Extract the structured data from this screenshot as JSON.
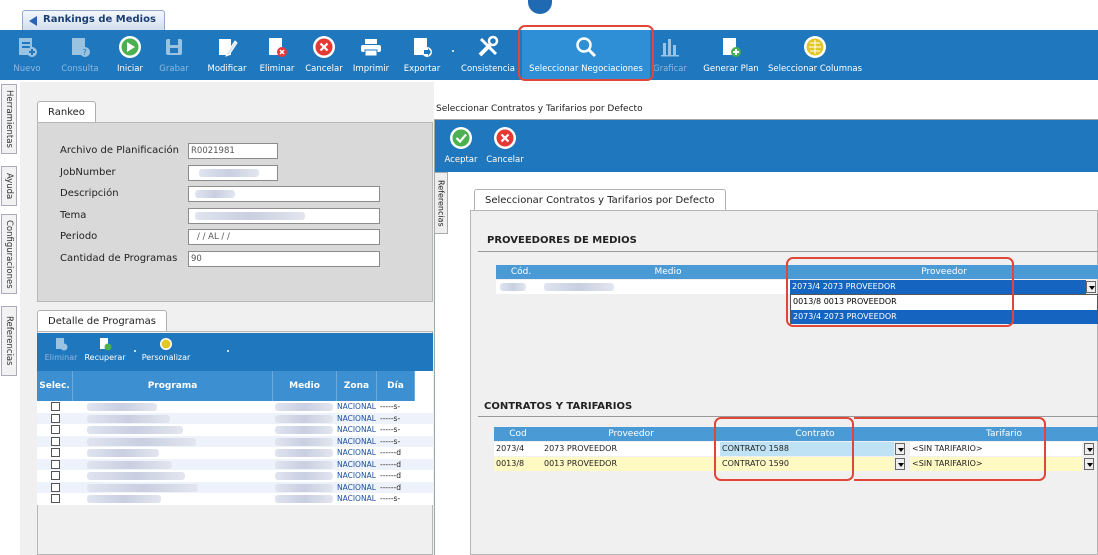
{
  "window": {
    "tab_title": "Rankings de Medios"
  },
  "toolbar": [
    {
      "label": "Nuevo",
      "icon": "new-doc-icon",
      "enabled": false
    },
    {
      "label": "Consulta",
      "icon": "query-doc-icon",
      "enabled": false
    },
    {
      "label": "Iniciar",
      "icon": "play-icon",
      "enabled": true
    },
    {
      "label": "Grabar",
      "icon": "save-icon",
      "enabled": false
    },
    {
      "label": "Modificar",
      "icon": "edit-icon",
      "enabled": true
    },
    {
      "label": "Eliminar",
      "icon": "delete-doc-icon",
      "enabled": true
    },
    {
      "label": "Cancelar",
      "icon": "cancel-icon",
      "enabled": true
    },
    {
      "label": "Imprimir",
      "icon": "print-icon",
      "enabled": true
    },
    {
      "label": "Exportar",
      "icon": "export-icon",
      "enabled": true
    },
    {
      "label": "Consistencia",
      "icon": "tools-icon",
      "enabled": true
    },
    {
      "label": "Seleccionar Negociaciones",
      "icon": "search-icon",
      "enabled": true,
      "selected": true
    },
    {
      "label": "Graficar",
      "icon": "chart-icon",
      "enabled": false
    },
    {
      "label": "Generar Plan",
      "icon": "generate-plan-icon",
      "enabled": true
    },
    {
      "label": "Seleccionar Columnas",
      "icon": "columns-icon",
      "enabled": true
    }
  ],
  "side_tabs": [
    "Herramientas",
    "Ayuda",
    "Configuraciones",
    "Referencias"
  ],
  "rankeo": {
    "tab": "Rankeo",
    "fields": {
      "archivo_label": "Archivo de Planificación",
      "archivo_value": "R0021981",
      "jobnumber_label": "JobNumber",
      "descripcion_label": "Descripción",
      "tema_label": "Tema",
      "periodo_label": "Periodo",
      "periodo_value": "/  /    AL  /  /",
      "cantidad_label": "Cantidad de Programas",
      "cantidad_value": "90"
    }
  },
  "detalle": {
    "tab": "Detalle de Programas",
    "toolbar": [
      "Eliminar",
      "Recuperar",
      "Personalizar"
    ],
    "columns": [
      "Selec.",
      "Programa",
      "Medio",
      "Zona",
      "Día"
    ],
    "rows": [
      {
        "zona": "NACIONAL",
        "dia": "-----s-"
      },
      {
        "zona": "NACIONAL",
        "dia": "-----s-"
      },
      {
        "zona": "NACIONAL",
        "dia": "-----s-"
      },
      {
        "zona": "NACIONAL",
        "dia": "-----s-"
      },
      {
        "zona": "NACIONAL",
        "dia": "------d"
      },
      {
        "zona": "NACIONAL",
        "dia": "------d"
      },
      {
        "zona": "NACIONAL",
        "dia": "------d"
      },
      {
        "zona": "NACIONAL",
        "dia": "------d"
      },
      {
        "zona": "NACIONAL",
        "dia": "-----s-"
      }
    ]
  },
  "dialog": {
    "title": "Seleccionar Contratos y Tarifarios por Defecto",
    "toolbar": {
      "accept": "Aceptar",
      "cancel": "Cancelar"
    },
    "side_tab": "Referencias",
    "inner_tab": "Seleccionar Contratos y Tarifarios por Defecto",
    "proveedores": {
      "section": "PROVEEDORES DE MEDIOS",
      "columns": [
        "Cód.",
        "Medio",
        "Proveedor"
      ],
      "selected": "2073/4  2073 PROVEEDOR",
      "options": [
        "0013/8  0013 PROVEEDOR",
        "2073/4  2073 PROVEEDOR"
      ]
    },
    "contratos": {
      "section": "CONTRATOS Y TARIFARIOS",
      "columns": [
        "Cod",
        "Proveedor",
        "Contrato",
        "Tarifario"
      ],
      "rows": [
        {
          "cod": "2073/4",
          "proveedor": "2073 PROVEEDOR",
          "contrato": "CONTRATO 1588",
          "tarifario": "<SIN TARIFARIO>"
        },
        {
          "cod": "0013/8",
          "proveedor": "0013 PROVEEDOR",
          "contrato": "CONTRATO 1590",
          "tarifario": "<SIN TARIFARIO>"
        }
      ]
    }
  },
  "colors": {
    "toolbar": "#1f78bd",
    "header": "#4a9ad6",
    "highlight": "#e0463a",
    "selection": "#1565c0",
    "row_alt": "#fff9c4"
  }
}
